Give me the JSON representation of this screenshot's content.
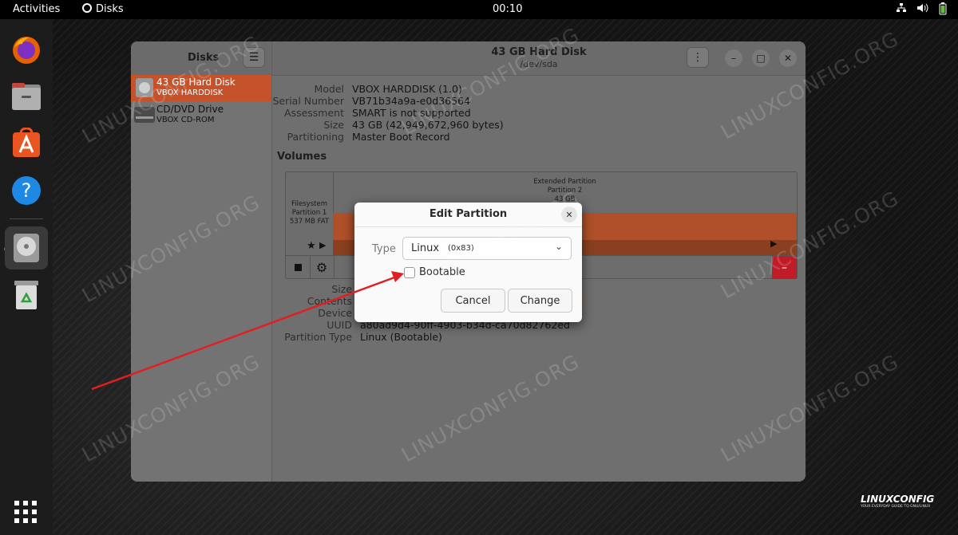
{
  "topbar": {
    "activities": "Activities",
    "app_name": "Disks",
    "clock": "00:10"
  },
  "window": {
    "sidebar_title": "Disks",
    "title": "43 GB Hard Disk",
    "subtitle": "/dev/sda",
    "devices": [
      {
        "name": "43 GB Hard Disk",
        "sub": "VBOX HARDDISK",
        "selected": true
      },
      {
        "name": "CD/DVD Drive",
        "sub": "VBOX CD-ROM",
        "selected": false
      }
    ],
    "details": [
      {
        "label": "Model",
        "value": "VBOX HARDDISK (1.0)"
      },
      {
        "label": "Serial Number",
        "value": "VB71b34a9a-e0d36564"
      },
      {
        "label": "Assessment",
        "value": "SMART is not supported"
      },
      {
        "label": "Size",
        "value": "43 GB (42,949,672,960 bytes)"
      },
      {
        "label": "Partitioning",
        "value": "Master Boot Record"
      }
    ],
    "volumes_heading": "Volumes",
    "volumes": {
      "partition1": {
        "l1": "Filesystem",
        "l2": "Partition 1",
        "l3": "537 MB FAT"
      },
      "extended": {
        "l1": "Extended Partition",
        "l2": "Partition 2",
        "l3": "43 GB"
      }
    },
    "volume_details": [
      {
        "label": "Size",
        "value": ""
      },
      {
        "label": "Contents",
        "value": "",
        "link": "t"
      },
      {
        "label": "Device",
        "value": ""
      },
      {
        "label": "UUID",
        "value": "a80ad9d4-90ff-4903-b34d-ca70d82762ed"
      },
      {
        "label": "Partition Type",
        "value": "Linux (Bootable)"
      }
    ]
  },
  "dialog": {
    "title": "Edit Partition",
    "type_label": "Type",
    "type_value": "Linux",
    "type_code": "(0x83)",
    "bootable_label": "Bootable",
    "bootable_checked": false,
    "cancel_label": "Cancel",
    "change_label": "Change"
  },
  "watermark": "LINUXCONFIG.ORG",
  "logo": {
    "name": "LINUXCONFIG",
    "tagline": "YOUR EVERYDAY GUIDE TO GNU/LINUX"
  },
  "colors": {
    "accent": "#e95420",
    "selected_row": "#c5522a",
    "danger": "#c01c28",
    "arrow": "#e02020"
  }
}
